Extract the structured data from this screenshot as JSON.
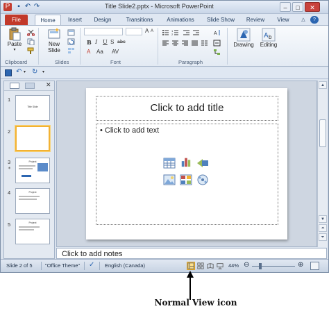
{
  "window": {
    "title": "Title Slide2.pptx - Microsoft PowerPoint",
    "buttons": {
      "minimize": "–",
      "maximize": "□",
      "close": "✕"
    }
  },
  "tabs": [
    {
      "label": "File"
    },
    {
      "label": "Home"
    },
    {
      "label": "Insert"
    },
    {
      "label": "Design"
    },
    {
      "label": "Transitions"
    },
    {
      "label": "Animations"
    },
    {
      "label": "Slide Show"
    },
    {
      "label": "Review"
    },
    {
      "label": "View"
    }
  ],
  "ribbon": {
    "groups": {
      "clipboard": "Clipboard",
      "slides": "Slides",
      "font": "Font",
      "paragraph": "Paragraph"
    },
    "paste_label": "Paste",
    "new_slide_label": "New\nSlide",
    "drawing_label": "Drawing",
    "editing_label": "Editing",
    "font_buttons": [
      "B",
      "I",
      "U",
      "S",
      "abc"
    ]
  },
  "slides": [
    {
      "number": "1",
      "text": "Title Slide"
    },
    {
      "number": "2",
      "text": ""
    },
    {
      "number": "3",
      "text": "Project"
    },
    {
      "number": "4",
      "text": "Project"
    },
    {
      "number": "5",
      "text": "Project"
    }
  ],
  "slide": {
    "title_placeholder": "Click to add title",
    "content_placeholder": "Click to add text",
    "bullet": "•"
  },
  "notes_placeholder": "Click to add notes",
  "status": {
    "slide_info": "Slide 2 of 5",
    "theme": "\"Office Theme\"",
    "language": "English (Canada)",
    "zoom": "44%"
  },
  "caption": "Normal View icon",
  "colors": {
    "file_tab": "#c2392a",
    "selected_thumb": "#f2b233",
    "normal_view_highlight": "#ffe08a"
  }
}
